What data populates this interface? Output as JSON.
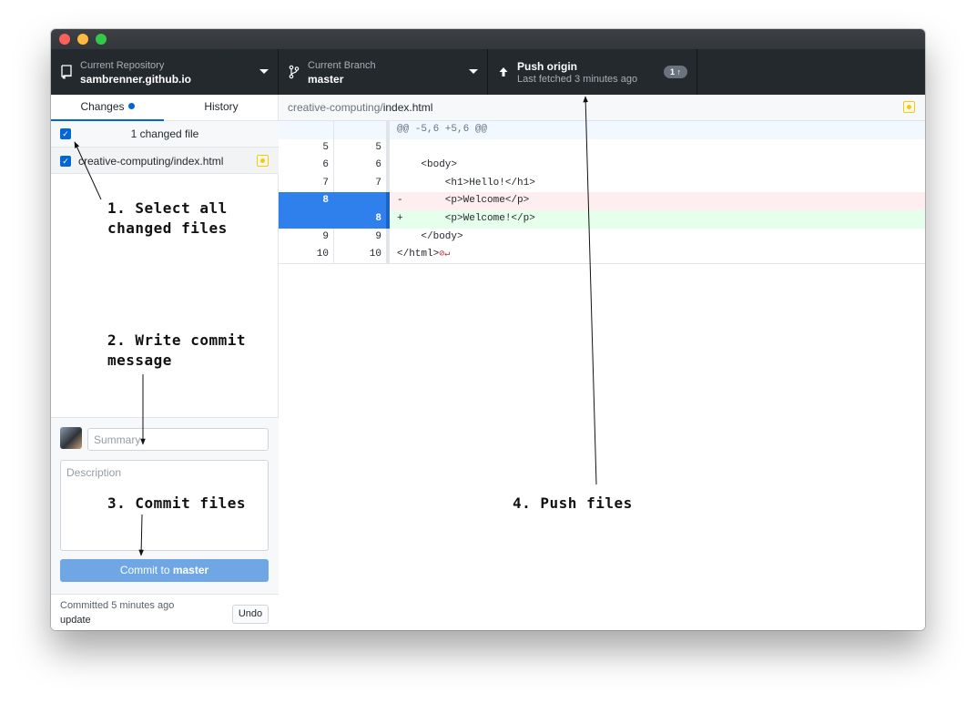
{
  "toolbar": {
    "repo": {
      "label": "Current Repository",
      "value": "sambrenner.github.io"
    },
    "branch": {
      "label": "Current Branch",
      "value": "master"
    },
    "push": {
      "label": "Push origin",
      "status": "Last fetched 3 minutes ago",
      "badge": "1 ↑"
    }
  },
  "sidebar": {
    "tabs": [
      {
        "label": "Changes"
      },
      {
        "label": "History"
      }
    ],
    "changed_files_header": "1 changed file",
    "files": [
      {
        "name": "creative-computing/index.html"
      }
    ],
    "commit": {
      "summary_placeholder": "Summary",
      "description_placeholder": "Description",
      "button_prefix": "Commit to ",
      "button_branch": "master"
    },
    "last_commit": {
      "time": "Committed 5 minutes ago",
      "message": "update",
      "undo_label": "Undo"
    }
  },
  "main": {
    "path": {
      "dir": "creative-computing/",
      "file": "index.html"
    },
    "diff": [
      {
        "type": "hunk",
        "old": "",
        "new": "",
        "code": "@@ -5,6 +5,6 @@"
      },
      {
        "type": "ctx",
        "old": "5",
        "new": "5",
        "code": ""
      },
      {
        "type": "ctx",
        "old": "6",
        "new": "6",
        "code": "    <body>"
      },
      {
        "type": "ctx",
        "old": "7",
        "new": "7",
        "code": "        <h1>Hello!</h1>"
      },
      {
        "type": "del",
        "old": "8",
        "new": "",
        "code": "-       <p>Welcome</p>"
      },
      {
        "type": "add",
        "old": "",
        "new": "8",
        "code": "+       <p>Welcome!</p>"
      },
      {
        "type": "ctx",
        "old": "9",
        "new": "9",
        "code": "    </body>"
      },
      {
        "type": "ctx",
        "old": "10",
        "new": "10",
        "code": "</html>",
        "nonl": "⊘↵"
      }
    ]
  },
  "annotations": {
    "step1": "1. Select all\nchanged files",
    "step2": "2. Write commit\nmessage",
    "step3": "3. Commit files",
    "step4": "4. Push files"
  }
}
